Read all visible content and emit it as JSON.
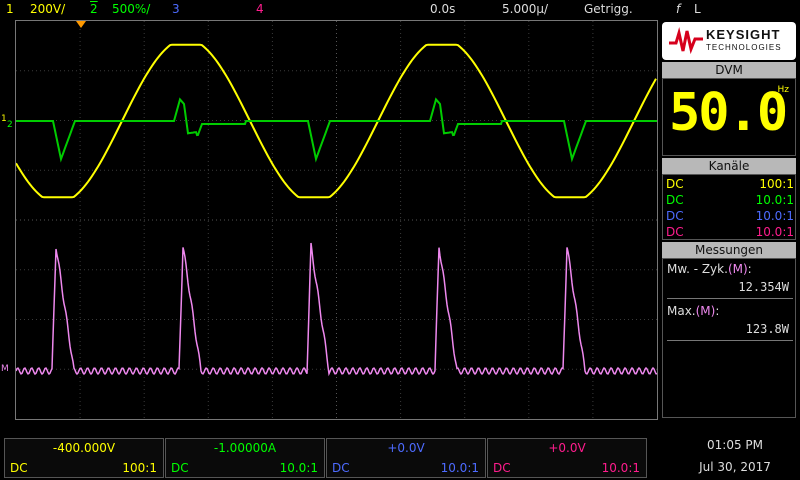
{
  "topbar": {
    "ch1_num": "1",
    "ch1_scale": "200V/",
    "ch2_num": "2",
    "ch2_scale": "500%/",
    "ch3_num": "3",
    "ch4_num": "4",
    "time_offset": "0.0s",
    "time_scale": "5.000µ/",
    "trigger_status": "Getrigg.",
    "trigger_icon": "f",
    "trigger_level": "L"
  },
  "brand": {
    "name": "KEYSIGHT",
    "sub": "TECHNOLOGIES"
  },
  "dvm": {
    "title": "DVM",
    "value": "50.0",
    "unit": "Hz"
  },
  "channels_panel": {
    "title": "Kanäle",
    "rows": [
      {
        "coupling": "DC",
        "probe": "100:1",
        "color": "#ffff00"
      },
      {
        "coupling": "DC",
        "probe": "10.0:1",
        "color": "#00ff00"
      },
      {
        "coupling": "DC",
        "probe": "10.0:1",
        "color": "#4d6bff"
      },
      {
        "coupling": "DC",
        "probe": "10.0:1",
        "color": "#ff1c8d"
      }
    ]
  },
  "measurements": {
    "title": "Messungen",
    "items": [
      {
        "label": "Mw. - Zyk.",
        "src": "(M)",
        "suffix": ":",
        "value": "12.354W"
      },
      {
        "label": "Max.",
        "src": "(M)",
        "suffix": ":",
        "value": "123.8W"
      }
    ]
  },
  "bottom_channels": [
    {
      "offset": "-400.000V",
      "coupling": "DC",
      "probe": "100:1",
      "color": "#ffff00"
    },
    {
      "offset": "-1.00000A",
      "coupling": "DC",
      "probe": "10.0:1",
      "color": "#00ff00"
    },
    {
      "offset": "+0.0V",
      "coupling": "DC",
      "probe": "10.0:1",
      "color": "#4d6bff"
    },
    {
      "offset": "+0.0V",
      "coupling": "DC",
      "probe": "10.0:1",
      "color": "#ff1c8d"
    }
  ],
  "clock": {
    "time": "01:05 PM",
    "date": "Jul 30, 2017"
  },
  "markers": {
    "ch1": "1",
    "ch2": "2",
    "math": "M"
  },
  "colors": {
    "ch1": "#ffff00",
    "ch2": "#00ff00",
    "ch3": "#4d6bff",
    "ch4": "#ff1c8d",
    "math": "#ee88ee",
    "trigger": "#ff9900"
  }
}
